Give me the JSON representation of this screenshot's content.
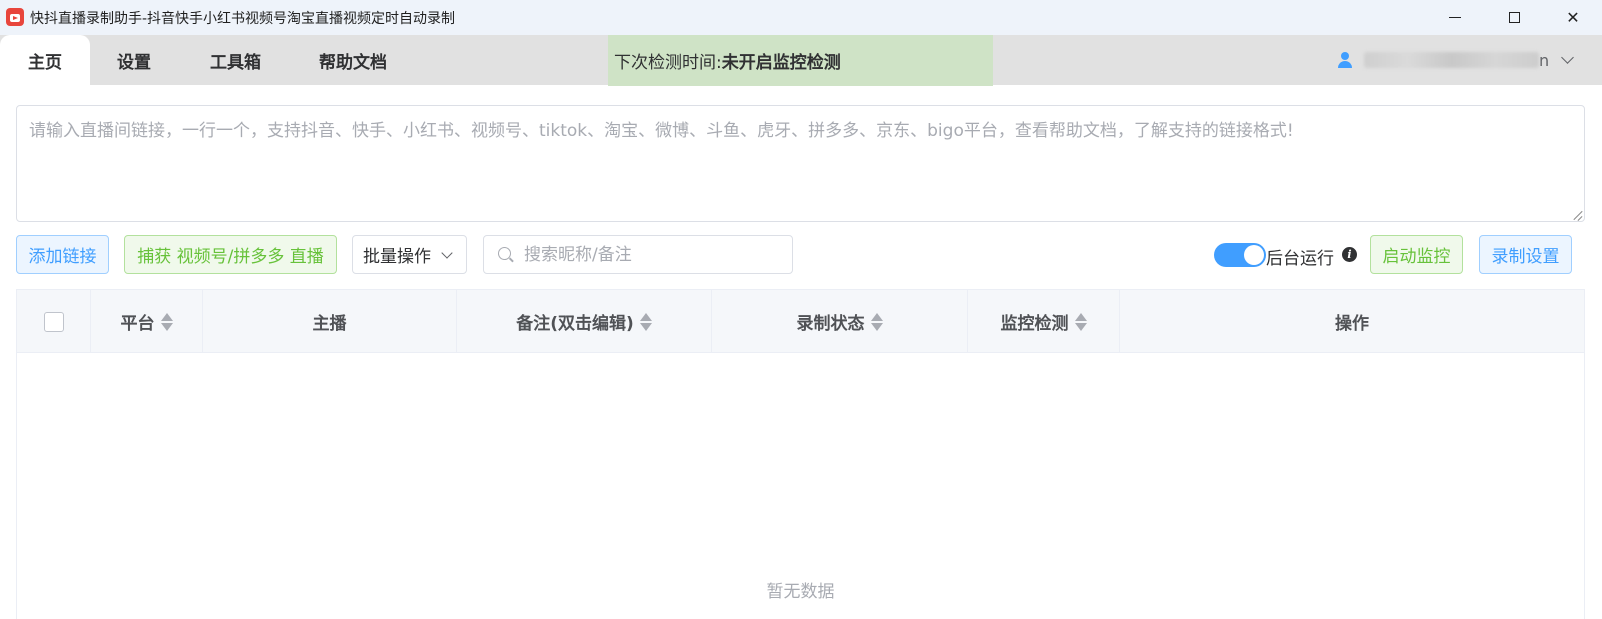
{
  "window": {
    "title": "快抖直播录制助手-抖音快手小红书视频号淘宝直播视频定时自动录制",
    "controls": {
      "minimize": "minimize",
      "maximize": "maximize",
      "close": "✕"
    }
  },
  "tabs": [
    {
      "label": "主页",
      "active": true
    },
    {
      "label": "设置",
      "active": false
    },
    {
      "label": "工具箱",
      "active": false
    },
    {
      "label": "帮助文档",
      "active": false
    }
  ],
  "monitor_status": {
    "label": "下次检测时间:",
    "value": "未开启监控检测"
  },
  "user": {
    "name_tail": "n"
  },
  "url_input": {
    "placeholder": "请输入直播间链接，一行一个，支持抖音、快手、小红书、视频号、tiktok、淘宝、微博、斗鱼、虎牙、拼多多、京东、bigo平台，查看帮助文档，了解支持的链接格式!"
  },
  "toolbar": {
    "add_link": "添加链接",
    "capture": "捕获 视频号/拼多多 直播",
    "batch": "批量操作",
    "search_placeholder": "搜索昵称/备注",
    "background_run": "后台运行",
    "background_run_enabled": true,
    "info": "i",
    "start_monitor": "启动监控",
    "record_settings": "录制设置"
  },
  "table": {
    "columns": [
      "平台",
      "主播",
      "备注(双击编辑)",
      "录制状态",
      "监控检测",
      "操作"
    ],
    "rows": [],
    "empty_text": "暂无数据"
  },
  "colors": {
    "primary": "#409eff",
    "success": "#67c23a",
    "status_bg": "#cfe3c6"
  }
}
